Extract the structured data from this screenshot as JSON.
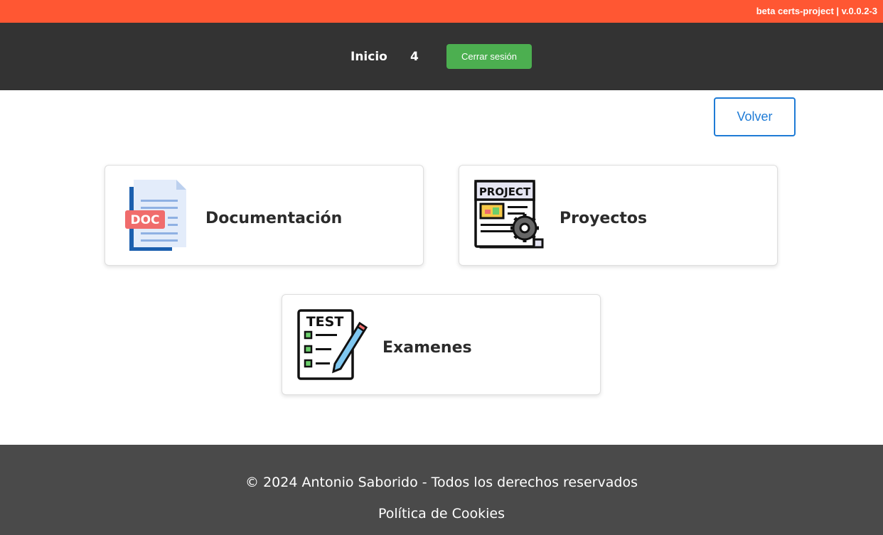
{
  "version_banner": "beta certs-project | v.0.0.2-3",
  "nav": {
    "home_label": "Inicio",
    "count": "4",
    "logout_label": "Cerrar sesión"
  },
  "back_label": "Volver",
  "cards": [
    {
      "title": "Documentación",
      "icon": "doc-file-icon",
      "icon_text": "DOC"
    },
    {
      "title": "Proyectos",
      "icon": "project-gear-icon",
      "icon_text": "PROJECT"
    },
    {
      "title": "Examenes",
      "icon": "test-checklist-icon",
      "icon_text": "TEST"
    }
  ],
  "footer": {
    "copyright": "© 2024 Antonio Saborido - Todos los derechos reservados",
    "cookies_label": "Política de Cookies"
  },
  "colors": {
    "topbar": "#ff5733",
    "navbar": "#333333",
    "logout_button": "#4caf50",
    "back_button": "#1e7bd6",
    "footer": "#4a4a4a"
  }
}
